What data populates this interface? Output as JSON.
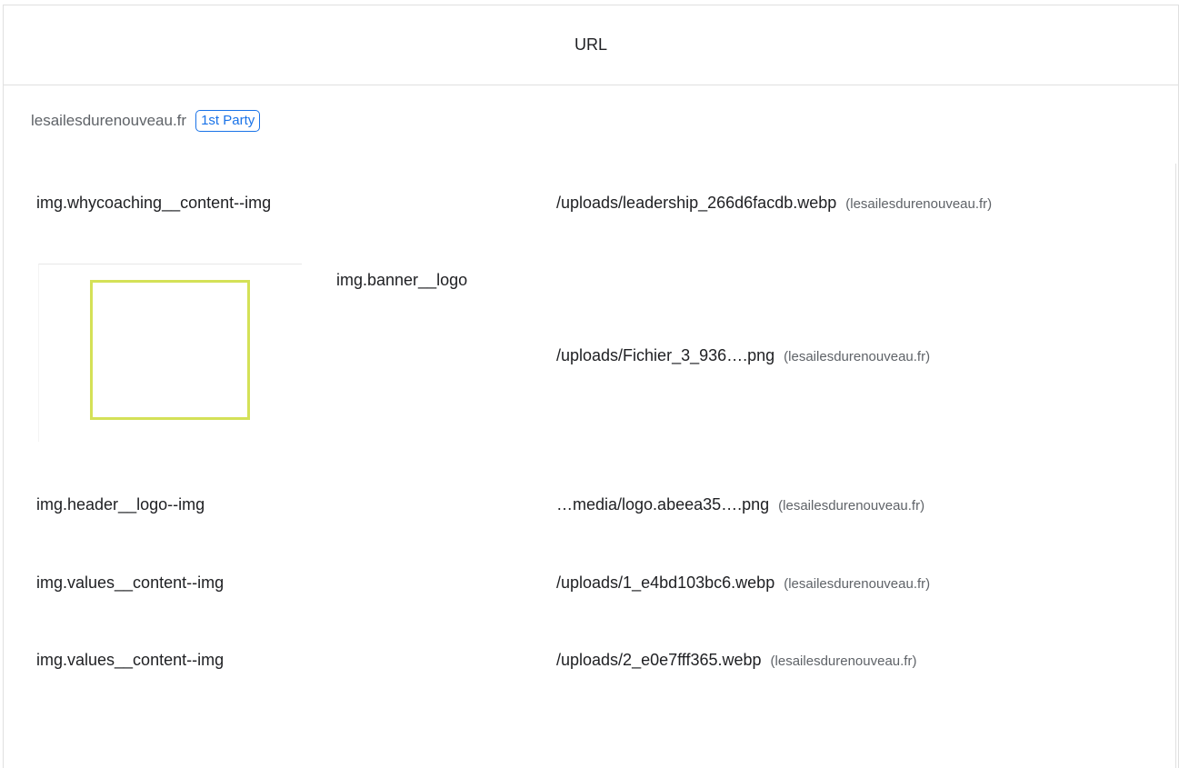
{
  "table": {
    "column_header": "URL",
    "origin": {
      "host": "lesailesdurenouveau.fr",
      "badge": "1st Party"
    },
    "rows": [
      {
        "element": "img.whycoaching__content--img",
        "url": "/uploads/leadership_266d6facdb.webp",
        "host": "(lesailesdurenouveau.fr)"
      },
      {
        "element": "img.banner__logo",
        "url": "/uploads/Fichier_3_936….png",
        "host": "(lesailesdurenouveau.fr)",
        "thumbnail": "square-outline-logo"
      },
      {
        "element": "img.header__logo--img",
        "url": "…media/logo.abeea35….png",
        "host": "(lesailesdurenouveau.fr)"
      },
      {
        "element": "img.values__content--img",
        "url": "/uploads/1_e4bd103bc6.webp",
        "host": "(lesailesdurenouveau.fr)"
      },
      {
        "element": "img.values__content--img",
        "url": "/uploads/2_e0e7fff365.webp",
        "host": "(lesailesdurenouveau.fr)"
      }
    ],
    "thumbnail_accent": "#d4e157"
  }
}
